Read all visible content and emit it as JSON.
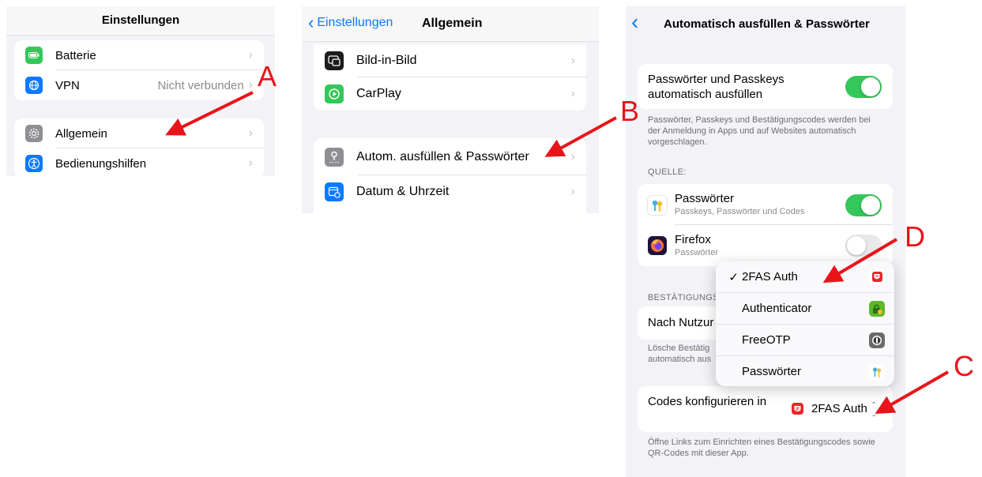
{
  "panel1": {
    "title": "Einstellungen",
    "items": [
      {
        "label": "Batterie",
        "value": "",
        "icon": "battery-icon",
        "color": "#34c759"
      },
      {
        "label": "VPN",
        "value": "Nicht verbunden",
        "icon": "globe-icon",
        "color": "#0a7aff"
      },
      {
        "label": "Allgemein",
        "value": "",
        "icon": "gear-icon",
        "color": "#8e8e93"
      },
      {
        "label": "Bedienungshilfen",
        "value": "",
        "icon": "accessibility-icon",
        "color": "#0a7aff"
      }
    ]
  },
  "panel2": {
    "back_label": "Einstellungen",
    "title": "Allgemein",
    "items": [
      {
        "label": "Bild-in-Bild",
        "icon": "picture-in-picture-icon",
        "color": "#1c1c1e"
      },
      {
        "label": "CarPlay",
        "icon": "carplay-icon",
        "color": "#34c759"
      },
      {
        "label": "Autom. ausfüllen & Passwörter",
        "icon": "key-icon",
        "color": "#8e8e93"
      },
      {
        "label": "Datum & Uhrzeit",
        "icon": "calendar-icon",
        "color": "#0a7aff"
      }
    ]
  },
  "panel3": {
    "title": "Automatisch ausfüllen & Passwörter",
    "autofill_label": "Passwörter und Passkeys automatisch ausfüllen",
    "autofill_on": true,
    "autofill_footnote": "Passwörter, Passkeys und Bestätigungscodes werden bei der Anmeldung in Apps und auf Websites automatisch vorgeschlagen.",
    "source_header": "QUELLE:",
    "sources": [
      {
        "label": "Passwörter",
        "sub": "Passkeys, Passwörter und Codes",
        "on": true,
        "icon": "passwords-app-icon"
      },
      {
        "label": "Firefox",
        "sub": "Passwörter",
        "on": false,
        "icon": "firefox-icon"
      }
    ],
    "verify_header": "BESTÄTIGUNGS",
    "after_use_label": "Nach Nutzur",
    "after_use_footnote": "Lösche Bestätig automatisch aus",
    "codes_label": "Codes konfigurieren in",
    "codes_value": "2FAS Auth",
    "codes_footnote": "Öffne Links zum Einrichten eines Bestätigungscodes sowie QR-Codes mit dieser App.",
    "menu": [
      {
        "label": "2FAS Auth",
        "checked": true,
        "icon": "2fas-icon",
        "color": "#e8262c"
      },
      {
        "label": "Authenticator",
        "checked": false,
        "icon": "authenticator-icon",
        "color": "#5cb82e"
      },
      {
        "label": "FreeOTP",
        "checked": false,
        "icon": "freeotp-icon",
        "color": "#6b6b6b"
      },
      {
        "label": "Passwörter",
        "checked": false,
        "icon": "passwords-app-icon",
        "color": "#f0c02a"
      }
    ],
    "checkmark": "✓"
  },
  "markers": {
    "a": "A",
    "b": "B",
    "c": "C",
    "d": "D"
  },
  "colors": {
    "toggle_on": "#34c759",
    "toggle_off": "#e9e9eb",
    "ios_blue": "#0a7aff",
    "arrow": "#e8141a"
  }
}
